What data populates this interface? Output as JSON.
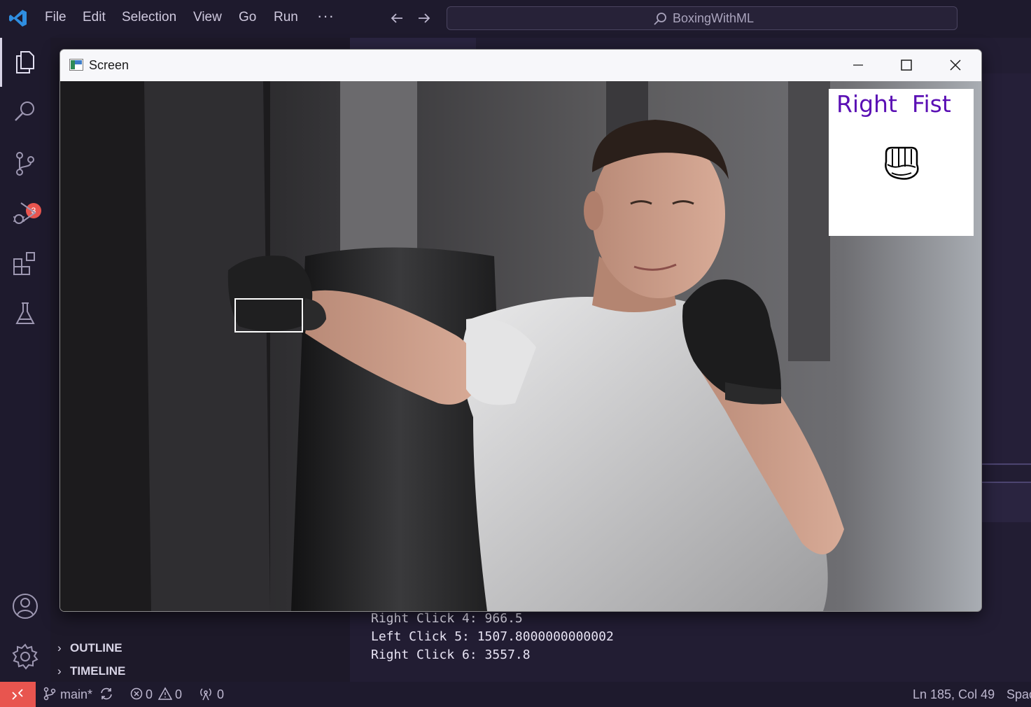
{
  "menubar": {
    "items": [
      "File",
      "Edit",
      "Selection",
      "View",
      "Go",
      "Run"
    ],
    "more": "···",
    "command_center": "BoxingWithML"
  },
  "activitybar": {
    "items": [
      "explorer-icon",
      "search-icon",
      "source-control-icon",
      "run-debug-icon",
      "extensions-icon",
      "testing-icon",
      "accounts-icon",
      "settings-gear-icon"
    ],
    "scm_badge": "3"
  },
  "sidebar": {
    "sections": [
      "OUTLINE",
      "TIMELINE"
    ]
  },
  "terminal": {
    "lines": [
      "Right Click 4: 966.5",
      "Left Click 5: 1507.8000000000002",
      "Right Click 6: 3557.8"
    ]
  },
  "statusbar": {
    "branch": "main*",
    "errors": "0",
    "warnings": "0",
    "ports": "0",
    "position": "Ln 185, Col 49",
    "spaces": "Spac"
  },
  "screen_window": {
    "title": "Screen",
    "prediction_label": "Right  Fist",
    "prediction_icon": "fist-icon"
  },
  "colors": {
    "accent": "#e8554f",
    "prediction_text": "#5a0fb4",
    "background": "#1e1a2d"
  }
}
